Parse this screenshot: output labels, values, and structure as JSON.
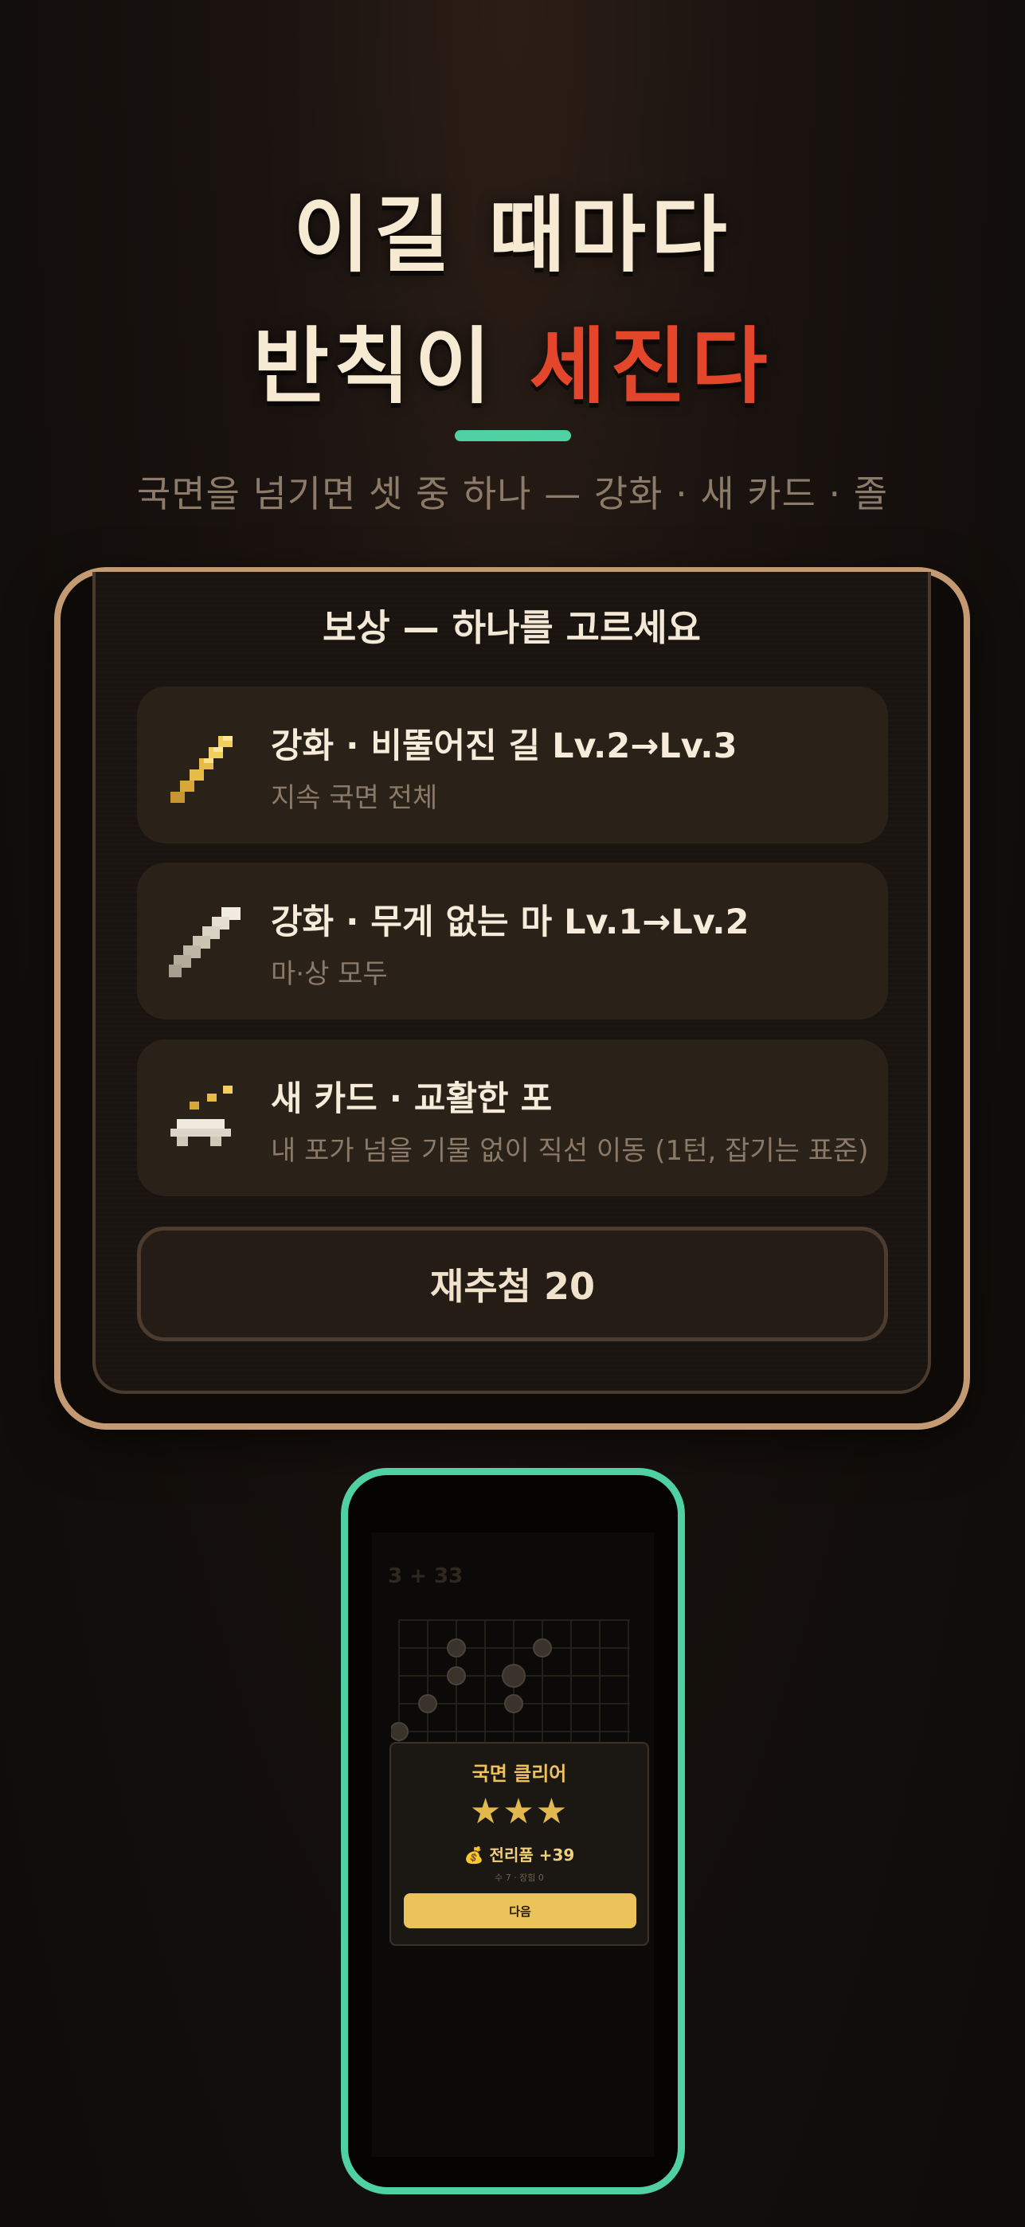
{
  "hero": {
    "line1": "이길 때마다",
    "line2_main": "반칙이 ",
    "line2_accent": "세진다",
    "subtitle": "국면을 넘기면 셋 중 하나 — 강화 · 새 카드 · 졸"
  },
  "reward_panel": {
    "title": "보상 — 하나를 고르세요",
    "options": [
      {
        "title": "강화 · 비뚤어진 길 Lv.2→Lv.3",
        "desc": "지속 국면 전체",
        "icon": "gold-pixel-stairs-icon"
      },
      {
        "title": "강화 · 무게 없는 마 Lv.1→Lv.2",
        "desc": "마·상 모두",
        "icon": "white-pixel-stairs-icon"
      },
      {
        "title": "새 카드 · 교활한 포",
        "desc": "내 포가 넘을 기물 없이 직선 이동 (1턴, 잡기는 표준)",
        "icon": "pixel-cannon-icon"
      }
    ],
    "reroll_label": "재추첨 20"
  },
  "phone_preview": {
    "status_left": "3 + 33",
    "modal": {
      "title": "국면 클리어",
      "stars": "★★★",
      "loot": "💰 전리품 +39",
      "meta": "수 7 · 장힘 0",
      "next_button": "다음"
    }
  },
  "colors": {
    "accent_red": "#e4462c",
    "mint": "#4fd1a4",
    "panel_border": "#c49a73",
    "gold": "#ecc35a"
  }
}
